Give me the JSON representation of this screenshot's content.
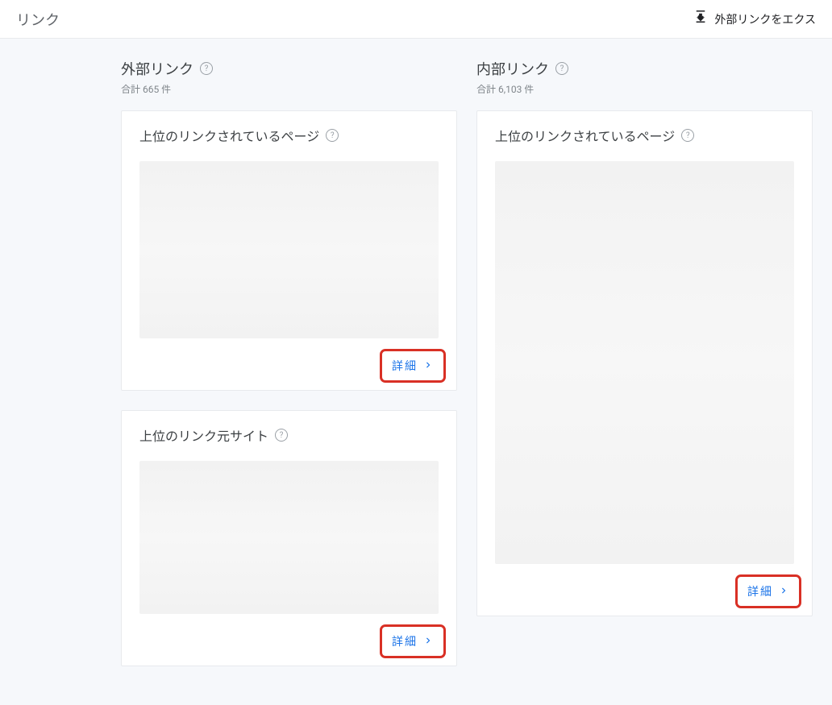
{
  "header": {
    "title": "リンク",
    "export_label": "外部リンクをエクス"
  },
  "external": {
    "title": "外部リンク",
    "total_label": "合計 665 件",
    "cards": [
      {
        "title": "上位のリンクされているページ",
        "details_label": "詳細"
      },
      {
        "title": "上位のリンク元サイト",
        "details_label": "詳細"
      }
    ]
  },
  "internal": {
    "title": "内部リンク",
    "total_label": "合計 6,103 件",
    "cards": [
      {
        "title": "上位のリンクされているページ",
        "details_label": "詳細"
      }
    ]
  },
  "help_glyph": "?"
}
